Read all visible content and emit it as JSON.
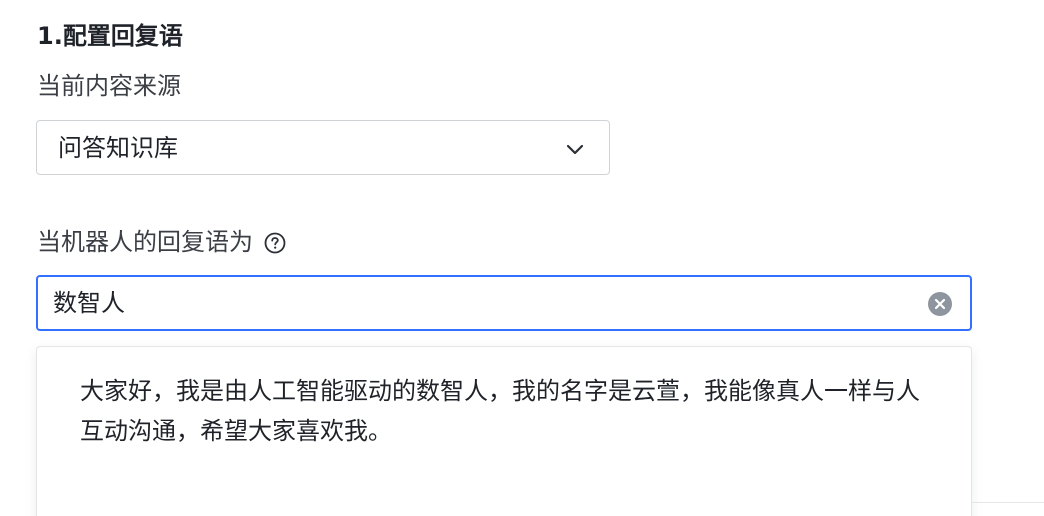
{
  "section": {
    "title": "1.配置回复语"
  },
  "source_field": {
    "label": "当前内容来源",
    "selected": "问答知识库",
    "chevron_icon": "chevron-down-icon"
  },
  "reply_field": {
    "label": "当机器人的回复语为",
    "help_icon": "question-circle-icon",
    "value": "数智人",
    "clear_icon": "clear-circle-icon",
    "accent_color": "#3370ff"
  },
  "suggestions": [
    {
      "text": "大家好，我是由人工智能驱动的数智人，我的名字是云萱，我能像真人一样与人互动沟通，希望大家喜欢我。"
    }
  ]
}
